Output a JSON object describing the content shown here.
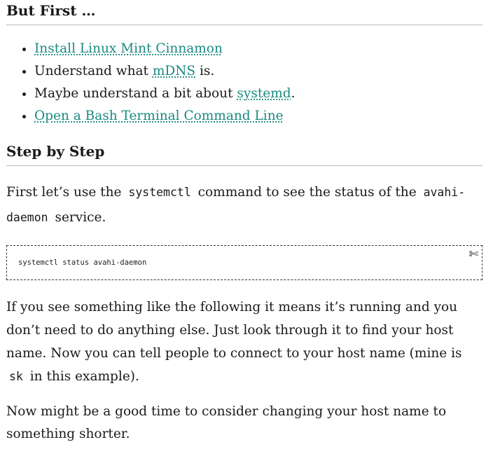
{
  "sections": {
    "first": {
      "heading": "But First …",
      "items": [
        {
          "link": "Install Linux Mint Cinnamon"
        },
        {
          "before": "Understand what ",
          "link": "mDNS",
          "after": " is."
        },
        {
          "before": "Maybe understand a bit about ",
          "link": "systemd",
          "after": "."
        },
        {
          "link": "Open a Bash Terminal Command Line"
        }
      ]
    },
    "steps": {
      "heading": "Step by Step",
      "p1": {
        "t1": "First let’s use the ",
        "c1": "systemctl",
        "t2": " command to see the status of the ",
        "c2": "avahi-daemon",
        "t3": " service."
      },
      "code": "systemctl status avahi-daemon",
      "copy_icon": "scissors-icon",
      "p2": {
        "t1": "If you see something like the following it means it’s running and you don’t need to do anything else. Just look through it to find your host name. Now you can tell people to connect to your host name (mine is ",
        "c1": "sk",
        "t2": " in this example)."
      },
      "p3": "Now might be a good time to consider changing your host name to something shorter."
    }
  },
  "colors": {
    "link": "#1a8a80",
    "text": "#1a1a1a",
    "rule": "#b8b8b8"
  }
}
